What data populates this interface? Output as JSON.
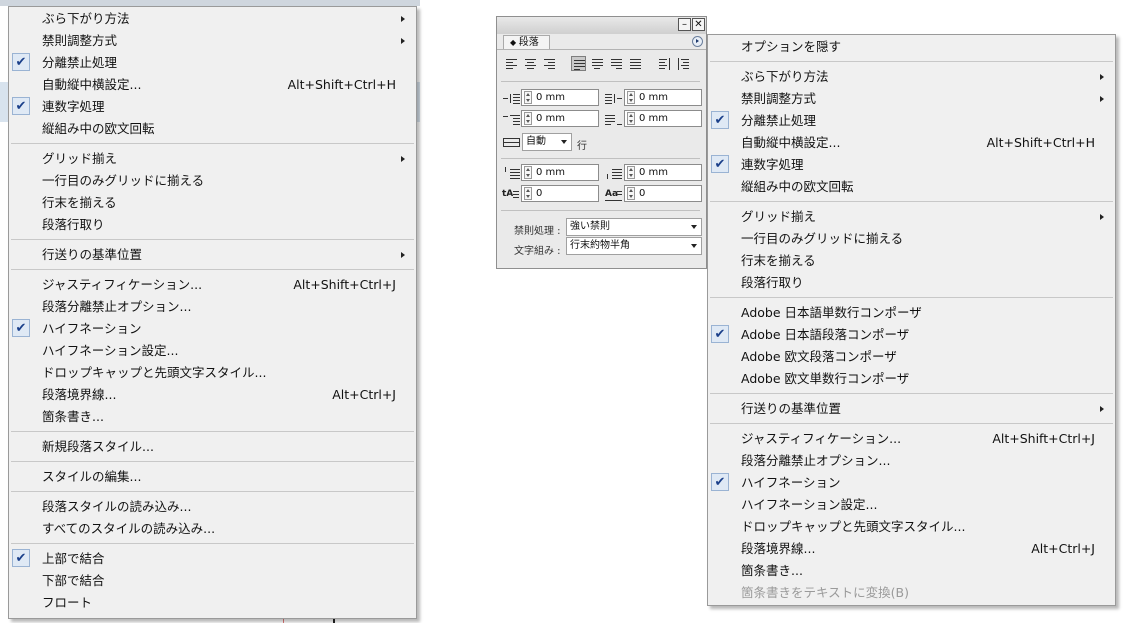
{
  "left_menu": {
    "items": [
      {
        "label": "ぶら下がり方法",
        "checked": false,
        "shortcut": "",
        "submenu": true
      },
      {
        "label": "禁則調整方式",
        "checked": false,
        "shortcut": "",
        "submenu": true
      },
      {
        "label": "分離禁止処理",
        "checked": true,
        "shortcut": "",
        "submenu": false
      },
      {
        "label": "自動縦中横設定...",
        "checked": false,
        "shortcut": "Alt+Shift+Ctrl+H",
        "submenu": false
      },
      {
        "label": "連数字処理",
        "checked": true,
        "shortcut": "",
        "submenu": false
      },
      {
        "label": "縦組み中の欧文回転",
        "checked": false,
        "shortcut": "",
        "submenu": false
      },
      {
        "separator": true
      },
      {
        "label": "グリッド揃え",
        "checked": false,
        "shortcut": "",
        "submenu": true
      },
      {
        "label": "一行目のみグリッドに揃える",
        "checked": false,
        "shortcut": "",
        "submenu": false
      },
      {
        "label": "行末を揃える",
        "checked": false,
        "shortcut": "",
        "submenu": false
      },
      {
        "label": "段落行取り",
        "checked": false,
        "shortcut": "",
        "submenu": false
      },
      {
        "separator": true
      },
      {
        "label": "行送りの基準位置",
        "checked": false,
        "shortcut": "",
        "submenu": true
      },
      {
        "separator": true
      },
      {
        "label": "ジャスティフィケーション...",
        "checked": false,
        "shortcut": "Alt+Shift+Ctrl+J",
        "submenu": false
      },
      {
        "label": "段落分離禁止オプション...",
        "checked": false,
        "shortcut": "",
        "submenu": false
      },
      {
        "label": "ハイフネーション",
        "checked": true,
        "shortcut": "",
        "submenu": false
      },
      {
        "label": "ハイフネーション設定...",
        "checked": false,
        "shortcut": "",
        "submenu": false
      },
      {
        "label": "ドロップキャップと先頭文字スタイル...",
        "checked": false,
        "shortcut": "",
        "submenu": false
      },
      {
        "label": "段落境界線...",
        "checked": false,
        "shortcut": "Alt+Ctrl+J",
        "submenu": false
      },
      {
        "label": "箇条書き...",
        "checked": false,
        "shortcut": "",
        "submenu": false
      },
      {
        "separator": true
      },
      {
        "label": "新規段落スタイル...",
        "checked": false,
        "shortcut": "",
        "submenu": false
      },
      {
        "separator": true
      },
      {
        "label": "スタイルの編集...",
        "checked": false,
        "shortcut": "",
        "submenu": false
      },
      {
        "separator": true
      },
      {
        "label": "段落スタイルの読み込み...",
        "checked": false,
        "shortcut": "",
        "submenu": false
      },
      {
        "label": "すべてのスタイルの読み込み...",
        "checked": false,
        "shortcut": "",
        "submenu": false
      },
      {
        "separator": true
      },
      {
        "label": "上部で結合",
        "checked": true,
        "shortcut": "",
        "submenu": false
      },
      {
        "label": "下部で結合",
        "checked": false,
        "shortcut": "",
        "submenu": false
      },
      {
        "label": "フロート",
        "checked": false,
        "shortcut": "",
        "submenu": false
      }
    ]
  },
  "right_menu": {
    "items": [
      {
        "label": "オプションを隠す",
        "checked": false,
        "shortcut": "",
        "submenu": false
      },
      {
        "separator": true
      },
      {
        "label": "ぶら下がり方法",
        "checked": false,
        "shortcut": "",
        "submenu": true
      },
      {
        "label": "禁則調整方式",
        "checked": false,
        "shortcut": "",
        "submenu": true
      },
      {
        "label": "分離禁止処理",
        "checked": true,
        "shortcut": "",
        "submenu": false
      },
      {
        "label": "自動縦中横設定...",
        "checked": false,
        "shortcut": "Alt+Shift+Ctrl+H",
        "submenu": false
      },
      {
        "label": "連数字処理",
        "checked": true,
        "shortcut": "",
        "submenu": false
      },
      {
        "label": "縦組み中の欧文回転",
        "checked": false,
        "shortcut": "",
        "submenu": false
      },
      {
        "separator": true
      },
      {
        "label": "グリッド揃え",
        "checked": false,
        "shortcut": "",
        "submenu": true
      },
      {
        "label": "一行目のみグリッドに揃える",
        "checked": false,
        "shortcut": "",
        "submenu": false
      },
      {
        "label": "行末を揃える",
        "checked": false,
        "shortcut": "",
        "submenu": false
      },
      {
        "label": "段落行取り",
        "checked": false,
        "shortcut": "",
        "submenu": false
      },
      {
        "separator": true
      },
      {
        "label": "Adobe 日本語単数行コンポーザ",
        "checked": false,
        "shortcut": "",
        "submenu": false
      },
      {
        "label": "Adobe 日本語段落コンポーザ",
        "checked": true,
        "shortcut": "",
        "submenu": false
      },
      {
        "label": "Adobe 欧文段落コンポーザ",
        "checked": false,
        "shortcut": "",
        "submenu": false
      },
      {
        "label": "Adobe 欧文単数行コンポーザ",
        "checked": false,
        "shortcut": "",
        "submenu": false
      },
      {
        "separator": true
      },
      {
        "label": "行送りの基準位置",
        "checked": false,
        "shortcut": "",
        "submenu": true
      },
      {
        "separator": true
      },
      {
        "label": "ジャスティフィケーション...",
        "checked": false,
        "shortcut": "Alt+Shift+Ctrl+J",
        "submenu": false
      },
      {
        "label": "段落分離禁止オプション...",
        "checked": false,
        "shortcut": "",
        "submenu": false
      },
      {
        "label": "ハイフネーション",
        "checked": true,
        "shortcut": "",
        "submenu": false
      },
      {
        "label": "ハイフネーション設定...",
        "checked": false,
        "shortcut": "",
        "submenu": false
      },
      {
        "label": "ドロップキャップと先頭文字スタイル...",
        "checked": false,
        "shortcut": "",
        "submenu": false
      },
      {
        "label": "段落境界線...",
        "checked": false,
        "shortcut": "Alt+Ctrl+J",
        "submenu": false
      },
      {
        "label": "箇条書き...",
        "checked": false,
        "shortcut": "",
        "submenu": false
      },
      {
        "label": "箇条書きをテキストに変換(B)",
        "checked": false,
        "shortcut": "",
        "submenu": false,
        "disabled": true
      }
    ]
  },
  "panel": {
    "tab_label": "段落",
    "minimize_glyph": "–",
    "close_glyph": "✕",
    "left_indent": "0 mm",
    "right_indent": "0 mm",
    "first_line_indent": "0 mm",
    "last_line_indent": "0 mm",
    "auto_value": "自動",
    "auto_unit": "行",
    "space_before": "0 mm",
    "space_after": "0 mm",
    "drop_cap_lines": "0",
    "drop_cap_chars": "0",
    "kinsoku_label": "禁則処理 :",
    "kinsoku_value": "強い禁則",
    "mojikumi_label": "文字組み :",
    "mojikumi_value": "行末約物半角"
  },
  "colors": {
    "menu_bg": "#f0f0f0",
    "check_bg": "#dfe9f5",
    "check_mark": "#1a3f8a",
    "disabled_text": "#9a9a9a"
  },
  "glyphs": {
    "check": "✔"
  }
}
